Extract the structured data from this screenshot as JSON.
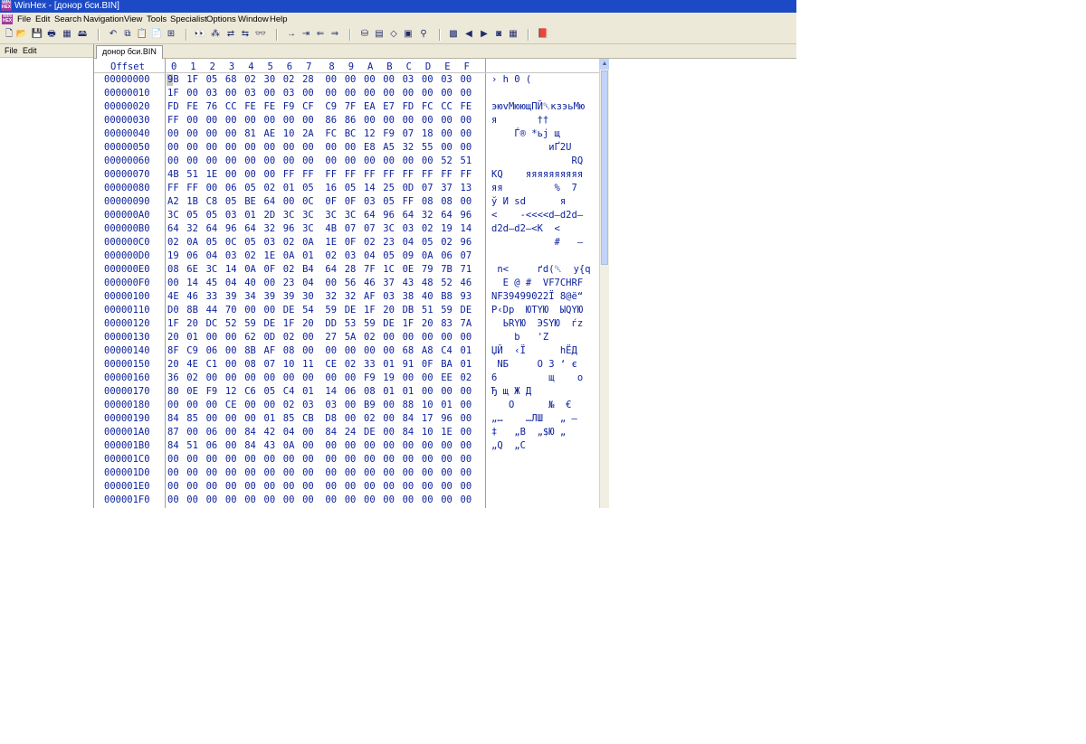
{
  "window": {
    "title": "WinHex - [донор бси.BIN]",
    "app_icon_text": "WIN HEX"
  },
  "menubar": {
    "items": [
      "File",
      "Edit",
      "Search",
      "Navigation",
      "View",
      "Tools",
      "Specialist",
      "Options",
      "Window",
      "Help"
    ]
  },
  "toolbar": {
    "buttons": [
      {
        "icon": "new-file-icon",
        "glyph": "🗋"
      },
      {
        "icon": "open-folder-icon",
        "glyph": "📂"
      },
      {
        "icon": "save-icon",
        "glyph": "💾"
      },
      {
        "icon": "print-icon",
        "glyph": "🖶"
      },
      {
        "icon": "properties-icon",
        "glyph": "▦"
      },
      {
        "icon": "open-disk-icon",
        "glyph": "🖴"
      },
      {
        "icon": "undo-icon",
        "glyph": "↶"
      },
      {
        "icon": "copy-block-icon",
        "glyph": "⧉"
      },
      {
        "icon": "clipboard-icon",
        "glyph": "📋"
      },
      {
        "icon": "paste-icon",
        "glyph": "📄"
      },
      {
        "icon": "paste-binary-icon",
        "glyph": "⊞"
      },
      {
        "icon": "find-text-icon",
        "glyph": "👀"
      },
      {
        "icon": "find-hex-icon",
        "glyph": "⁂"
      },
      {
        "icon": "replace-text-icon",
        "glyph": "⇄"
      },
      {
        "icon": "replace-hex-icon",
        "glyph": "⇆"
      },
      {
        "icon": "find-again-icon",
        "glyph": "👓"
      },
      {
        "icon": "goto-offset-icon",
        "glyph": "→"
      },
      {
        "icon": "goto-sector-icon",
        "glyph": "⇥"
      },
      {
        "icon": "back-icon",
        "glyph": "⇐"
      },
      {
        "icon": "forward-icon",
        "glyph": "⇒"
      },
      {
        "icon": "disk-tools-icon",
        "glyph": "⛁"
      },
      {
        "icon": "ram-editor-icon",
        "glyph": "▤"
      },
      {
        "icon": "eraser-icon",
        "glyph": "◇"
      },
      {
        "icon": "calculator-icon",
        "glyph": "▣"
      },
      {
        "icon": "hex-converter-icon",
        "glyph": "⚲"
      },
      {
        "icon": "film-strip-icon",
        "glyph": "▩"
      },
      {
        "icon": "previous-icon",
        "glyph": "◀"
      },
      {
        "icon": "next-icon",
        "glyph": "▶"
      },
      {
        "icon": "camera-icon",
        "glyph": "◙"
      },
      {
        "icon": "table-icon",
        "glyph": "▦"
      },
      {
        "icon": "help-book-icon",
        "glyph": "📕"
      }
    ]
  },
  "leftpanel": {
    "menu": [
      "File",
      "Edit"
    ]
  },
  "tab": {
    "label": "донор бси.BIN"
  },
  "hexview": {
    "offset_header": "Offset",
    "columns": [
      "0",
      "1",
      "2",
      "3",
      "4",
      "5",
      "6",
      "7",
      "8",
      "9",
      "A",
      "B",
      "C",
      "D",
      "E",
      "F"
    ],
    "rows": [
      {
        "offset": "00000000",
        "hex": [
          "9B",
          "1F",
          "05",
          "68",
          "02",
          "30",
          "02",
          "28",
          "00",
          "00",
          "00",
          "00",
          "03",
          "00",
          "03",
          "00"
        ],
        "text": "› h 0 ("
      },
      {
        "offset": "00000010",
        "hex": [
          "1F",
          "00",
          "03",
          "00",
          "03",
          "00",
          "03",
          "00",
          "00",
          "00",
          "00",
          "00",
          "00",
          "00",
          "00",
          "00"
        ],
        "text": ""
      },
      {
        "offset": "00000020",
        "hex": [
          "FD",
          "FE",
          "76",
          "CC",
          "FE",
          "FE",
          "F9",
          "CF",
          "C9",
          "7F",
          "EA",
          "E7",
          "FD",
          "FC",
          "CC",
          "FE"
        ],
        "text": "эюvМюющПЙ␡кзэьМю"
      },
      {
        "offset": "00000030",
        "hex": [
          "FF",
          "00",
          "00",
          "00",
          "00",
          "00",
          "00",
          "00",
          "86",
          "86",
          "00",
          "00",
          "00",
          "00",
          "00",
          "00"
        ],
        "text": "я       ††"
      },
      {
        "offset": "00000040",
        "hex": [
          "00",
          "00",
          "00",
          "00",
          "81",
          "AE",
          "10",
          "2A",
          "FC",
          "BC",
          "12",
          "F9",
          "07",
          "18",
          "00",
          "00"
        ],
        "text": "    Ѓ® *ьј щ"
      },
      {
        "offset": "00000050",
        "hex": [
          "00",
          "00",
          "00",
          "00",
          "00",
          "00",
          "00",
          "00",
          "00",
          "00",
          "E8",
          "A5",
          "32",
          "55",
          "00",
          "00"
        ],
        "text": "          иҐ2U"
      },
      {
        "offset": "00000060",
        "hex": [
          "00",
          "00",
          "00",
          "00",
          "00",
          "00",
          "00",
          "00",
          "00",
          "00",
          "00",
          "00",
          "00",
          "00",
          "52",
          "51"
        ],
        "text": "              RQ"
      },
      {
        "offset": "00000070",
        "hex": [
          "4B",
          "51",
          "1E",
          "00",
          "00",
          "00",
          "FF",
          "FF",
          "FF",
          "FF",
          "FF",
          "FF",
          "FF",
          "FF",
          "FF",
          "FF"
        ],
        "text": "KQ    яяяяяяяяяя"
      },
      {
        "offset": "00000080",
        "hex": [
          "FF",
          "FF",
          "00",
          "06",
          "05",
          "02",
          "01",
          "05",
          "16",
          "05",
          "14",
          "25",
          "0D",
          "07",
          "37",
          "13"
        ],
        "text": "яя         %  7"
      },
      {
        "offset": "00000090",
        "hex": [
          "A2",
          "1B",
          "C8",
          "05",
          "BE",
          "64",
          "00",
          "0C",
          "0F",
          "0F",
          "03",
          "05",
          "FF",
          "08",
          "08",
          "00"
        ],
        "text": "ў И ѕd      я"
      },
      {
        "offset": "000000A0",
        "hex": [
          "3C",
          "05",
          "05",
          "03",
          "01",
          "2D",
          "3C",
          "3C",
          "3C",
          "3C",
          "64",
          "96",
          "64",
          "32",
          "64",
          "96"
        ],
        "text": "<    -<<<<d–d2d–"
      },
      {
        "offset": "000000B0",
        "hex": [
          "64",
          "32",
          "64",
          "96",
          "64",
          "32",
          "96",
          "3C",
          "4B",
          "07",
          "07",
          "3C",
          "03",
          "02",
          "19",
          "14"
        ],
        "text": "d2d–d2–<K  <"
      },
      {
        "offset": "000000C0",
        "hex": [
          "02",
          "0A",
          "05",
          "0C",
          "05",
          "03",
          "02",
          "0A",
          "1E",
          "0F",
          "02",
          "23",
          "04",
          "05",
          "02",
          "96"
        ],
        "text": "           #   –"
      },
      {
        "offset": "000000D0",
        "hex": [
          "19",
          "06",
          "04",
          "03",
          "02",
          "1E",
          "0A",
          "01",
          "02",
          "03",
          "04",
          "05",
          "09",
          "0A",
          "06",
          "07"
        ],
        "text": ""
      },
      {
        "offset": "000000E0",
        "hex": [
          "08",
          "6E",
          "3C",
          "14",
          "0A",
          "0F",
          "02",
          "B4",
          "64",
          "28",
          "7F",
          "1C",
          "0E",
          "79",
          "7B",
          "71"
        ],
        "text": " n<     ґd(␡  y{q"
      },
      {
        "offset": "000000F0",
        "hex": [
          "00",
          "14",
          "45",
          "04",
          "40",
          "00",
          "23",
          "04",
          "00",
          "56",
          "46",
          "37",
          "43",
          "48",
          "52",
          "46"
        ],
        "text": "  E @ #  VF7CHRF"
      },
      {
        "offset": "00000100",
        "hex": [
          "4E",
          "46",
          "33",
          "39",
          "34",
          "39",
          "39",
          "30",
          "32",
          "32",
          "AF",
          "03",
          "38",
          "40",
          "B8",
          "93"
        ],
        "text": "NF39499022Ї 8@ё“"
      },
      {
        "offset": "00000110",
        "hex": [
          "D0",
          "8B",
          "44",
          "70",
          "00",
          "00",
          "DE",
          "54",
          "59",
          "DE",
          "1F",
          "20",
          "DB",
          "51",
          "59",
          "DE"
        ],
        "text": "Р‹Dp  ЮTYЮ  ЫQYЮ"
      },
      {
        "offset": "00000120",
        "hex": [
          "1F",
          "20",
          "DC",
          "52",
          "59",
          "DE",
          "1F",
          "20",
          "DD",
          "53",
          "59",
          "DE",
          "1F",
          "20",
          "83",
          "7A"
        ],
        "text": "  ЬRYЮ  ЭSYЮ  ѓz"
      },
      {
        "offset": "00000130",
        "hex": [
          "20",
          "01",
          "00",
          "00",
          "62",
          "0D",
          "02",
          "00",
          "27",
          "5A",
          "02",
          "00",
          "00",
          "00",
          "00",
          "00"
        ],
        "text": "    b   'Z"
      },
      {
        "offset": "00000140",
        "hex": [
          "8F",
          "C9",
          "06",
          "00",
          "8B",
          "AF",
          "08",
          "00",
          "00",
          "00",
          "00",
          "00",
          "68",
          "A8",
          "C4",
          "01"
        ],
        "text": "ЏЙ  ‹Ї      hЁД"
      },
      {
        "offset": "00000150",
        "hex": [
          "20",
          "4E",
          "C1",
          "00",
          "08",
          "07",
          "10",
          "11",
          "CE",
          "02",
          "33",
          "01",
          "91",
          "0F",
          "BA",
          "01"
        ],
        "text": " NБ     О 3 ‘ є"
      },
      {
        "offset": "00000160",
        "hex": [
          "36",
          "02",
          "00",
          "00",
          "00",
          "00",
          "00",
          "00",
          "00",
          "00",
          "F9",
          "19",
          "00",
          "00",
          "EE",
          "02"
        ],
        "text": "6         щ    о"
      },
      {
        "offset": "00000170",
        "hex": [
          "80",
          "0E",
          "F9",
          "12",
          "C6",
          "05",
          "C4",
          "01",
          "14",
          "06",
          "08",
          "01",
          "01",
          "00",
          "00",
          "00"
        ],
        "text": "Ђ щ Ж Д"
      },
      {
        "offset": "00000180",
        "hex": [
          "00",
          "00",
          "00",
          "CE",
          "00",
          "00",
          "02",
          "03",
          "03",
          "00",
          "B9",
          "00",
          "88",
          "10",
          "01",
          "00"
        ],
        "text": "   О      №  €"
      },
      {
        "offset": "00000190",
        "hex": [
          "84",
          "85",
          "00",
          "00",
          "00",
          "01",
          "85",
          "CB",
          "D8",
          "00",
          "02",
          "00",
          "84",
          "17",
          "96",
          "00"
        ],
        "text": "„…    …ЛШ   „ –"
      },
      {
        "offset": "000001A0",
        "hex": [
          "87",
          "00",
          "06",
          "00",
          "84",
          "42",
          "04",
          "00",
          "84",
          "24",
          "DE",
          "00",
          "84",
          "10",
          "1E",
          "00"
        ],
        "text": "‡   „B  „$Ю „"
      },
      {
        "offset": "000001B0",
        "hex": [
          "84",
          "51",
          "06",
          "00",
          "84",
          "43",
          "0A",
          "00",
          "00",
          "00",
          "00",
          "00",
          "00",
          "00",
          "00",
          "00"
        ],
        "text": "„Q  „C"
      },
      {
        "offset": "000001C0",
        "hex": [
          "00",
          "00",
          "00",
          "00",
          "00",
          "00",
          "00",
          "00",
          "00",
          "00",
          "00",
          "00",
          "00",
          "00",
          "00",
          "00"
        ],
        "text": ""
      },
      {
        "offset": "000001D0",
        "hex": [
          "00",
          "00",
          "00",
          "00",
          "00",
          "00",
          "00",
          "00",
          "00",
          "00",
          "00",
          "00",
          "00",
          "00",
          "00",
          "00"
        ],
        "text": ""
      },
      {
        "offset": "000001E0",
        "hex": [
          "00",
          "00",
          "00",
          "00",
          "00",
          "00",
          "00",
          "00",
          "00",
          "00",
          "00",
          "00",
          "00",
          "00",
          "00",
          "00"
        ],
        "text": ""
      },
      {
        "offset": "000001F0",
        "hex": [
          "00",
          "00",
          "00",
          "00",
          "00",
          "00",
          "00",
          "00",
          "00",
          "00",
          "00",
          "00",
          "00",
          "00",
          "00",
          "00"
        ],
        "text": ""
      }
    ]
  }
}
